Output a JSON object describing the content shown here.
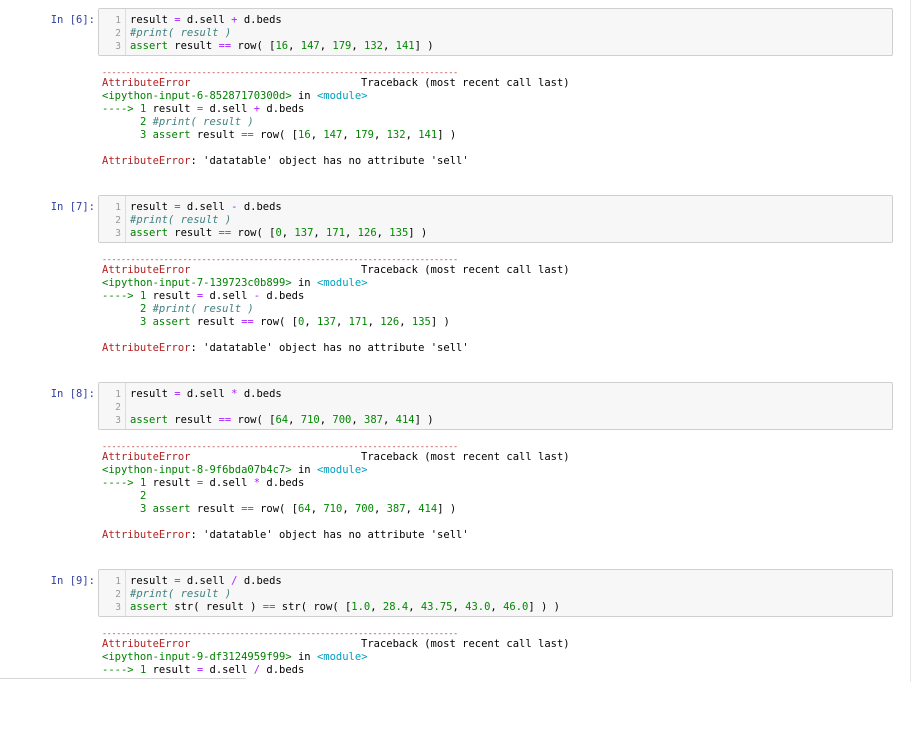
{
  "cells": [
    {
      "prompt": "In [6]:",
      "lines": [
        {
          "n": "1",
          "tokens": [
            [
              "t",
              "result "
            ],
            [
              "op",
              "="
            ],
            [
              "t",
              " d.sell "
            ],
            [
              "op",
              "+"
            ],
            [
              "t",
              " d.beds"
            ]
          ]
        },
        {
          "n": "2",
          "tokens": [
            [
              "cm",
              "#print( result )"
            ]
          ]
        },
        {
          "n": "3",
          "tokens": [
            [
              "kw",
              "assert"
            ],
            [
              "t",
              " result "
            ],
            [
              "op",
              "=="
            ],
            [
              "t",
              " row( ["
            ],
            [
              "num",
              "16"
            ],
            [
              "t",
              ", "
            ],
            [
              "num",
              "147"
            ],
            [
              "t",
              ", "
            ],
            [
              "num",
              "179"
            ],
            [
              "t",
              ", "
            ],
            [
              "num",
              "132"
            ],
            [
              "t",
              ", "
            ],
            [
              "num",
              "141"
            ],
            [
              "t",
              "] )"
            ]
          ]
        }
      ],
      "error": {
        "separator": "---------------------------------------------------------------------------",
        "header_name": "AttributeError",
        "header_trace": "Traceback (most recent call last)",
        "input_ref": "<ipython-input-6-85287170300d>",
        "in_text": " in ",
        "module": "<module>",
        "trace_lines": [
          {
            "prefix": "----> ",
            "n": "1",
            "tokens": [
              [
                "t",
                " result "
              ],
              [
                "op",
                "="
              ],
              [
                "t",
                " d.sell "
              ],
              [
                "op",
                "+"
              ],
              [
                "t",
                " d.beds"
              ]
            ]
          },
          {
            "prefix": "      ",
            "n": "2",
            "tokens": [
              [
                "cm",
                " #print( result )"
              ]
            ]
          },
          {
            "prefix": "      ",
            "n": "3",
            "tokens": [
              [
                "t",
                " "
              ],
              [
                "kw",
                "assert"
              ],
              [
                "t",
                " result "
              ],
              [
                "op",
                "=="
              ],
              [
                "t",
                " row( ["
              ],
              [
                "num",
                "16"
              ],
              [
                "t",
                ", "
              ],
              [
                "num",
                "147"
              ],
              [
                "t",
                ", "
              ],
              [
                "num",
                "179"
              ],
              [
                "t",
                ", "
              ],
              [
                "num",
                "132"
              ],
              [
                "t",
                ", "
              ],
              [
                "num",
                "141"
              ],
              [
                "t",
                "] )"
              ]
            ]
          }
        ],
        "message_name": "AttributeError",
        "message_text": ": 'datatable' object has no attribute 'sell'"
      }
    },
    {
      "prompt": "In [7]:",
      "lines": [
        {
          "n": "1",
          "tokens": [
            [
              "t",
              "result "
            ],
            [
              "op",
              "="
            ],
            [
              "t",
              " d.sell "
            ],
            [
              "op",
              "-"
            ],
            [
              "t",
              " d.beds"
            ]
          ]
        },
        {
          "n": "2",
          "tokens": [
            [
              "cm",
              "#print( result )"
            ]
          ]
        },
        {
          "n": "3",
          "tokens": [
            [
              "kw",
              "assert"
            ],
            [
              "t",
              " result "
            ],
            [
              "op",
              "=="
            ],
            [
              "t",
              " row( ["
            ],
            [
              "num",
              "0"
            ],
            [
              "t",
              ", "
            ],
            [
              "num",
              "137"
            ],
            [
              "t",
              ", "
            ],
            [
              "num",
              "171"
            ],
            [
              "t",
              ", "
            ],
            [
              "num",
              "126"
            ],
            [
              "t",
              ", "
            ],
            [
              "num",
              "135"
            ],
            [
              "t",
              "] )"
            ]
          ]
        }
      ],
      "error": {
        "separator": "---------------------------------------------------------------------------",
        "header_name": "AttributeError",
        "header_trace": "Traceback (most recent call last)",
        "input_ref": "<ipython-input-7-139723c0b899>",
        "in_text": " in ",
        "module": "<module>",
        "trace_lines": [
          {
            "prefix": "----> ",
            "n": "1",
            "tokens": [
              [
                "t",
                " result "
              ],
              [
                "op",
                "="
              ],
              [
                "t",
                " d.sell "
              ],
              [
                "op",
                "-"
              ],
              [
                "t",
                " d.beds"
              ]
            ]
          },
          {
            "prefix": "      ",
            "n": "2",
            "tokens": [
              [
                "cm",
                " #print( result )"
              ]
            ]
          },
          {
            "prefix": "      ",
            "n": "3",
            "tokens": [
              [
                "t",
                " "
              ],
              [
                "kw",
                "assert"
              ],
              [
                "t",
                " result "
              ],
              [
                "op",
                "=="
              ],
              [
                "t",
                " row( ["
              ],
              [
                "num",
                "0"
              ],
              [
                "t",
                ", "
              ],
              [
                "num",
                "137"
              ],
              [
                "t",
                ", "
              ],
              [
                "num",
                "171"
              ],
              [
                "t",
                ", "
              ],
              [
                "num",
                "126"
              ],
              [
                "t",
                ", "
              ],
              [
                "num",
                "135"
              ],
              [
                "t",
                "] )"
              ]
            ]
          }
        ],
        "message_name": "AttributeError",
        "message_text": ": 'datatable' object has no attribute 'sell'"
      }
    },
    {
      "prompt": "In [8]:",
      "lines": [
        {
          "n": "1",
          "tokens": [
            [
              "t",
              "result "
            ],
            [
              "op",
              "="
            ],
            [
              "t",
              " d.sell "
            ],
            [
              "op",
              "*"
            ],
            [
              "t",
              " d.beds"
            ]
          ]
        },
        {
          "n": "2",
          "tokens": []
        },
        {
          "n": "3",
          "tokens": [
            [
              "kw",
              "assert"
            ],
            [
              "t",
              " result "
            ],
            [
              "op",
              "=="
            ],
            [
              "t",
              " row( ["
            ],
            [
              "num",
              "64"
            ],
            [
              "t",
              ", "
            ],
            [
              "num",
              "710"
            ],
            [
              "t",
              ", "
            ],
            [
              "num",
              "700"
            ],
            [
              "t",
              ", "
            ],
            [
              "num",
              "387"
            ],
            [
              "t",
              ", "
            ],
            [
              "num",
              "414"
            ],
            [
              "t",
              "] )"
            ]
          ]
        }
      ],
      "error": {
        "separator": "---------------------------------------------------------------------------",
        "header_name": "AttributeError",
        "header_trace": "Traceback (most recent call last)",
        "input_ref": "<ipython-input-8-9f6bda07b4c7>",
        "in_text": " in ",
        "module": "<module>",
        "trace_lines": [
          {
            "prefix": "----> ",
            "n": "1",
            "tokens": [
              [
                "t",
                " result "
              ],
              [
                "op",
                "="
              ],
              [
                "t",
                " d.sell "
              ],
              [
                "op",
                "*"
              ],
              [
                "t",
                " d.beds"
              ]
            ]
          },
          {
            "prefix": "      ",
            "n": "2",
            "tokens": []
          },
          {
            "prefix": "      ",
            "n": "3",
            "tokens": [
              [
                "t",
                " "
              ],
              [
                "kw",
                "assert"
              ],
              [
                "t",
                " result "
              ],
              [
                "op",
                "=="
              ],
              [
                "t",
                " row( ["
              ],
              [
                "num",
                "64"
              ],
              [
                "t",
                ", "
              ],
              [
                "num",
                "710"
              ],
              [
                "t",
                ", "
              ],
              [
                "num",
                "700"
              ],
              [
                "t",
                ", "
              ],
              [
                "num",
                "387"
              ],
              [
                "t",
                ", "
              ],
              [
                "num",
                "414"
              ],
              [
                "t",
                "] )"
              ]
            ]
          }
        ],
        "message_name": "AttributeError",
        "message_text": ": 'datatable' object has no attribute 'sell'"
      }
    },
    {
      "prompt": "In [9]:",
      "lines": [
        {
          "n": "1",
          "tokens": [
            [
              "t",
              "result "
            ],
            [
              "op",
              "="
            ],
            [
              "t",
              " d.sell "
            ],
            [
              "op",
              "/"
            ],
            [
              "t",
              " d.beds"
            ]
          ]
        },
        {
          "n": "2",
          "tokens": [
            [
              "cm",
              "#print( result )"
            ]
          ]
        },
        {
          "n": "3",
          "tokens": [
            [
              "kw",
              "assert"
            ],
            [
              "t",
              " str( result ) "
            ],
            [
              "op",
              "=="
            ],
            [
              "t",
              " str( row( ["
            ],
            [
              "num",
              "1.0"
            ],
            [
              "t",
              ", "
            ],
            [
              "num",
              "28.4"
            ],
            [
              "t",
              ", "
            ],
            [
              "num",
              "43.75"
            ],
            [
              "t",
              ", "
            ],
            [
              "num",
              "43.0"
            ],
            [
              "t",
              ", "
            ],
            [
              "num",
              "46.0"
            ],
            [
              "t",
              "] ) )"
            ]
          ]
        }
      ],
      "error": {
        "separator": "---------------------------------------------------------------------------",
        "header_name": "AttributeError",
        "header_trace": "Traceback (most recent call last)",
        "input_ref": "<ipython-input-9-df3124959f99>",
        "in_text": " in ",
        "module": "<module>",
        "trace_lines": [
          {
            "prefix": "----> ",
            "n": "1",
            "tokens": [
              [
                "t",
                " result "
              ],
              [
                "op",
                "="
              ],
              [
                "t",
                " d.sell "
              ],
              [
                "op",
                "/"
              ],
              [
                "t",
                " d.beds"
              ]
            ]
          }
        ],
        "message_name": "",
        "message_text": ""
      }
    }
  ]
}
